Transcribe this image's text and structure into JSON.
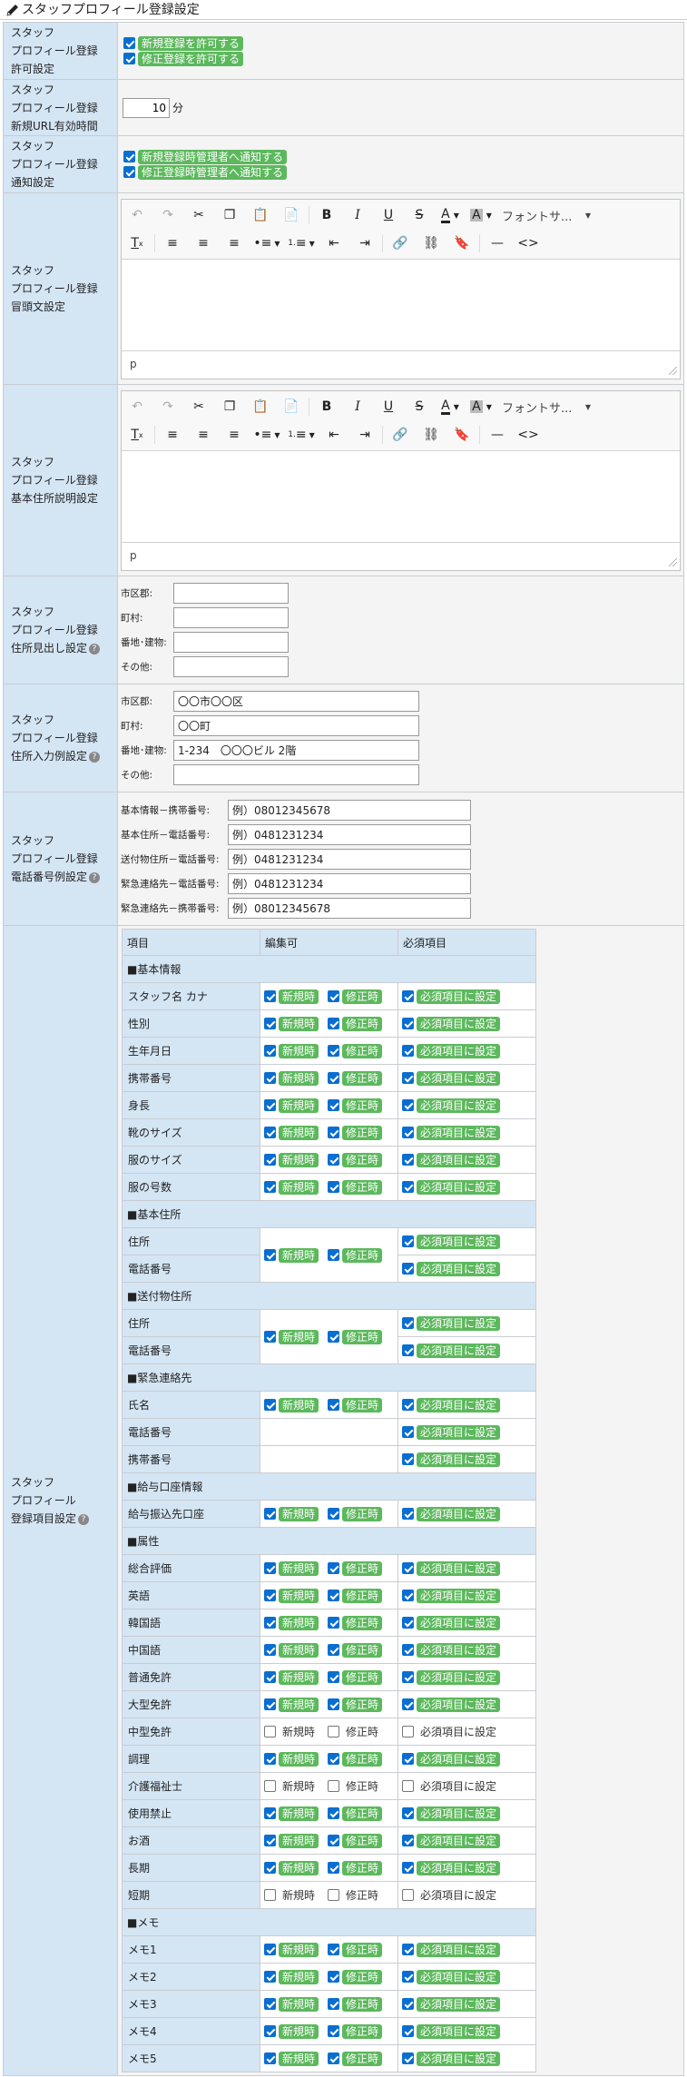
{
  "page": {
    "title": "スタッフプロフィール登録設定",
    "title_icon": "pencil-icon"
  },
  "colors": {
    "label_bg": "#d4e5f4",
    "badge_green": "#5cb85c",
    "checkbox_blue": "#0a6ed1"
  },
  "sections": {
    "permission": {
      "label": [
        "スタッフ",
        "プロフィール登録",
        "許可設定"
      ],
      "options": [
        {
          "text": "新規登録を許可する",
          "checked": true
        },
        {
          "text": "修正登録を許可する",
          "checked": true
        }
      ]
    },
    "url_expiry": {
      "label": [
        "スタッフ",
        "プロフィール登録",
        "新規URL有効時間"
      ],
      "value": "10",
      "unit": "分"
    },
    "notification": {
      "label": [
        "スタッフ",
        "プロフィール登録",
        "通知設定"
      ],
      "options": [
        {
          "text": "新規登録時管理者へ通知する",
          "checked": true
        },
        {
          "text": "修正登録時管理者へ通知する",
          "checked": true
        }
      ]
    },
    "intro_text": {
      "label": [
        "スタッフ",
        "プロフィール登録",
        "冒頭文設定"
      ],
      "font_select": "フォントサ...",
      "status": "p"
    },
    "address_desc": {
      "label": [
        "スタッフ",
        "プロフィール登録",
        "基本住所説明設定"
      ],
      "font_select": "フォントサ...",
      "status": "p"
    },
    "address_heading": {
      "label": [
        "スタッフ",
        "プロフィール登録",
        "住所見出し設定"
      ],
      "help": "?",
      "fields": [
        {
          "label": "市区郡:",
          "value": ""
        },
        {
          "label": "町村:",
          "value": ""
        },
        {
          "label": "番地･建物:",
          "value": ""
        },
        {
          "label": "その他:",
          "value": ""
        }
      ]
    },
    "address_example": {
      "label": [
        "スタッフ",
        "プロフィール登録",
        "住所入力例設定"
      ],
      "help": "?",
      "fields": [
        {
          "label": "市区郡:",
          "value": "〇〇市〇〇区"
        },
        {
          "label": "町村:",
          "value": "〇〇町"
        },
        {
          "label": "番地･建物:",
          "value": "1-234　〇〇〇ビル 2階"
        },
        {
          "label": "その他:",
          "value": ""
        }
      ]
    },
    "phone_example": {
      "label": [
        "スタッフ",
        "プロフィール登録",
        "電話番号例設定"
      ],
      "help": "?",
      "fields": [
        {
          "label": "基本情報－携帯番号:",
          "value": "例）08012345678"
        },
        {
          "label": "基本住所－電話番号:",
          "value": "例）0481231234"
        },
        {
          "label": "送付物住所－電話番号:",
          "value": "例）0481231234"
        },
        {
          "label": "緊急連絡先－電話番号:",
          "value": "例）0481231234"
        },
        {
          "label": "緊急連絡先－携帯番号:",
          "value": "例）08012345678"
        }
      ]
    },
    "items": {
      "label": [
        "スタッフ",
        "プロフィール",
        "登録項目設定"
      ],
      "help": "?",
      "headers": {
        "item": "項目",
        "editable": "編集可",
        "required": "必須項目"
      },
      "new_label": "新規時",
      "edit_label": "修正時",
      "req_label": "必須項目に設定",
      "groups": [
        {
          "title": "■基本情報",
          "rows": [
            {
              "name": "スタッフ名 カナ",
              "edit": true,
              "new": true,
              "mod": true,
              "req": true
            },
            {
              "name": "性別",
              "edit": true,
              "new": true,
              "mod": true,
              "req": true
            },
            {
              "name": "生年月日",
              "edit": true,
              "new": true,
              "mod": true,
              "req": true
            },
            {
              "name": "携帯番号",
              "edit": true,
              "new": true,
              "mod": true,
              "req": true
            },
            {
              "name": "身長",
              "edit": true,
              "new": true,
              "mod": true,
              "req": true
            },
            {
              "name": "靴のサイズ",
              "edit": true,
              "new": true,
              "mod": true,
              "req": true
            },
            {
              "name": "服のサイズ",
              "edit": true,
              "new": true,
              "mod": true,
              "req": true
            },
            {
              "name": "服の号数",
              "edit": true,
              "new": true,
              "mod": true,
              "req": true
            }
          ]
        },
        {
          "title": "■基本住所",
          "merged": {
            "new": true,
            "mod": true
          },
          "rows": [
            {
              "name": "住所",
              "req": true
            },
            {
              "name": "電話番号",
              "req": true
            }
          ]
        },
        {
          "title": "■送付物住所",
          "merged": {
            "new": true,
            "mod": true
          },
          "rows": [
            {
              "name": "住所",
              "req": true
            },
            {
              "name": "電話番号",
              "req": true
            }
          ]
        },
        {
          "title": "■緊急連絡先",
          "rows": [
            {
              "name": "氏名",
              "edit": true,
              "new": true,
              "mod": true,
              "req": true
            },
            {
              "name": "電話番号",
              "edit": false,
              "req": true
            },
            {
              "name": "携帯番号",
              "edit": false,
              "req": true
            }
          ]
        },
        {
          "title": "■給与口座情報",
          "rows": [
            {
              "name": "給与振込先口座",
              "edit": true,
              "new": true,
              "mod": true,
              "req": true
            }
          ]
        },
        {
          "title": "■属性",
          "rows": [
            {
              "name": "総合評価",
              "edit": true,
              "new": true,
              "mod": true,
              "req": true
            },
            {
              "name": "英語",
              "edit": true,
              "new": true,
              "mod": true,
              "req": true
            },
            {
              "name": "韓国語",
              "edit": true,
              "new": true,
              "mod": true,
              "req": true
            },
            {
              "name": "中国語",
              "edit": true,
              "new": true,
              "mod": true,
              "req": true
            },
            {
              "name": "普通免許",
              "edit": true,
              "new": true,
              "mod": true,
              "req": true
            },
            {
              "name": "大型免許",
              "edit": true,
              "new": true,
              "mod": true,
              "req": true
            },
            {
              "name": "中型免許",
              "edit": true,
              "new": false,
              "mod": false,
              "req": false
            },
            {
              "name": "調理",
              "edit": true,
              "new": true,
              "mod": true,
              "req": true
            },
            {
              "name": "介護福祉士",
              "edit": true,
              "new": false,
              "mod": false,
              "req": false
            },
            {
              "name": "使用禁止",
              "edit": true,
              "new": true,
              "mod": true,
              "req": true
            },
            {
              "name": "お酒",
              "edit": true,
              "new": true,
              "mod": true,
              "req": true
            },
            {
              "name": "長期",
              "edit": true,
              "new": true,
              "mod": true,
              "req": true
            },
            {
              "name": "短期",
              "edit": true,
              "new": false,
              "mod": false,
              "req": false
            }
          ]
        },
        {
          "title": "■メモ",
          "rows": [
            {
              "name": "メモ1",
              "edit": true,
              "new": true,
              "mod": true,
              "req": true
            },
            {
              "name": "メモ2",
              "edit": true,
              "new": true,
              "mod": true,
              "req": true
            },
            {
              "name": "メモ3",
              "edit": true,
              "new": true,
              "mod": true,
              "req": true
            },
            {
              "name": "メモ4",
              "edit": true,
              "new": true,
              "mod": true,
              "req": true
            },
            {
              "name": "メモ5",
              "edit": true,
              "new": true,
              "mod": true,
              "req": true
            }
          ]
        }
      ]
    }
  }
}
